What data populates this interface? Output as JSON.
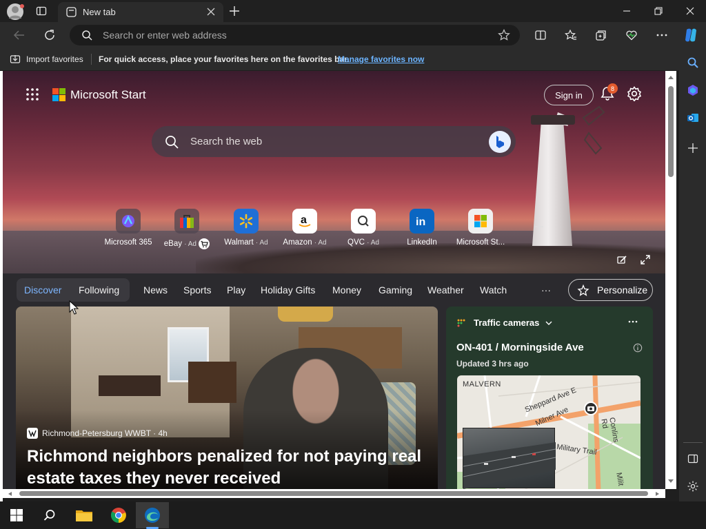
{
  "browser": {
    "tab_title": "New tab",
    "address_placeholder": "Search or enter web address"
  },
  "favorites_bar": {
    "import_label": "Import favorites",
    "message": "For quick access, place your favorites here on the favorites bar.",
    "manage_link": "Manage favorites now"
  },
  "page": {
    "brand": "Microsoft Start",
    "sign_in": "Sign in",
    "notification_count": "8",
    "search_placeholder": "Search the web",
    "quick_links": [
      {
        "label": "Microsoft 365",
        "ad": ""
      },
      {
        "label": "eBay",
        "ad": "· Ad"
      },
      {
        "label": "Walmart",
        "ad": "· Ad"
      },
      {
        "label": "Amazon",
        "ad": "· Ad"
      },
      {
        "label": "QVC",
        "ad": "· Ad"
      },
      {
        "label": "LinkedIn",
        "ad": ""
      },
      {
        "label": "Microsoft St...",
        "ad": ""
      }
    ],
    "feed_nav": {
      "discover": "Discover",
      "following": "Following",
      "items": [
        "News",
        "Sports",
        "Play",
        "Holiday Gifts",
        "Money",
        "Gaming",
        "Weather",
        "Watch"
      ],
      "more": "···",
      "personalize": "Personalize"
    },
    "article": {
      "source": "Richmond-Petersburg WWBT · 4h",
      "title": "Richmond neighbors penalized for not paying real estate taxes they never received"
    },
    "traffic": {
      "heading": "Traffic cameras",
      "location": "ON-401 / Morningside Ave",
      "updated": "Updated 3 hrs ago",
      "map_labels": [
        "MALVERN",
        "Sheppard Ave E",
        "Milner Ave",
        "Conlins Rd",
        "Military Trail",
        "Milit"
      ]
    }
  },
  "colors": {
    "accent_link": "#6cb4ff",
    "badge": "#e25b2e",
    "edge_blue": "#0f6cbd"
  }
}
